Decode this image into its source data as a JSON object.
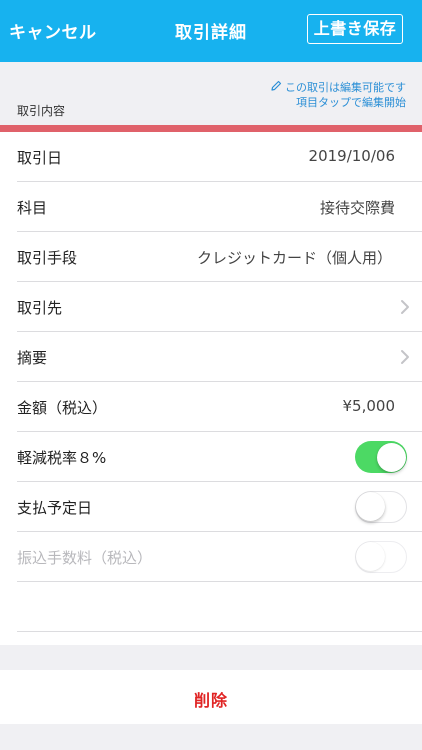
{
  "header": {
    "cancel_label": "キャンセル",
    "title": "取引詳細",
    "save_label": "上書き保存",
    "bg_color": "#17b2ef"
  },
  "section": {
    "edit_note_line1": "この取引は編集可能です",
    "edit_note_line2": "項目タップで編集開始",
    "title": "取引内容",
    "accent_color": "#e0616a"
  },
  "rows": {
    "date": {
      "label": "取引日",
      "value": "2019/10/06"
    },
    "account": {
      "label": "科目",
      "value": "接待交際費"
    },
    "method": {
      "label": "取引手段",
      "value": "クレジットカード（個人用）"
    },
    "partner": {
      "label": "取引先"
    },
    "memo": {
      "label": "摘要"
    },
    "amount": {
      "label": "金額（税込）",
      "value": "¥5,000"
    },
    "reduced_tax": {
      "label": "軽減税率８%",
      "toggle": "on"
    },
    "payment_date": {
      "label": "支払予定日",
      "toggle": "off"
    },
    "transfer_fee": {
      "label": "振込手数料（税込）",
      "toggle": "off",
      "disabled": true
    }
  },
  "footer": {
    "delete_label": "削除",
    "delete_color": "#e02424"
  },
  "icons": {
    "edit": "pencil-icon",
    "chevron": "chevron-right-icon"
  }
}
